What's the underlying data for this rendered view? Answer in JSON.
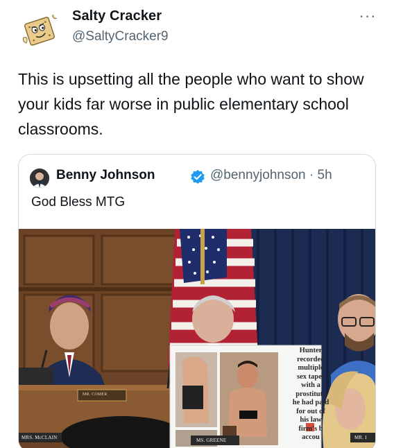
{
  "author": {
    "name": "Salty Cracker",
    "handle": "@SaltyCracker9",
    "avatar_icon": "cracker-cartoon-avatar"
  },
  "more_icon": "more-options-icon",
  "more_glyph": "···",
  "tweet_text": "This is upsetting all the people who want to show your kids far worse in public elementary school classrooms.",
  "quoted": {
    "name": "Benny Johnson",
    "verified_icon": "verified-badge-icon",
    "handle": "@bennyjohnson",
    "separator": "·",
    "time": "5h",
    "text": "God Bless MTG",
    "photo": {
      "sign_lines": [
        "Hunter",
        "recorded",
        "multiple",
        "sex tapes",
        "with a",
        "prostitute",
        "he had paid",
        "for out of",
        "his law",
        "firm's b",
        "accou"
      ],
      "placards": [
        "MRS. McCLAIN",
        "MS. GREENE",
        "MR. I",
        "MR. COMER"
      ]
    }
  },
  "colors": {
    "text": "#0f1419",
    "secondary": "#536471",
    "border": "#cfd9de",
    "verified": "#1d9bf0"
  }
}
